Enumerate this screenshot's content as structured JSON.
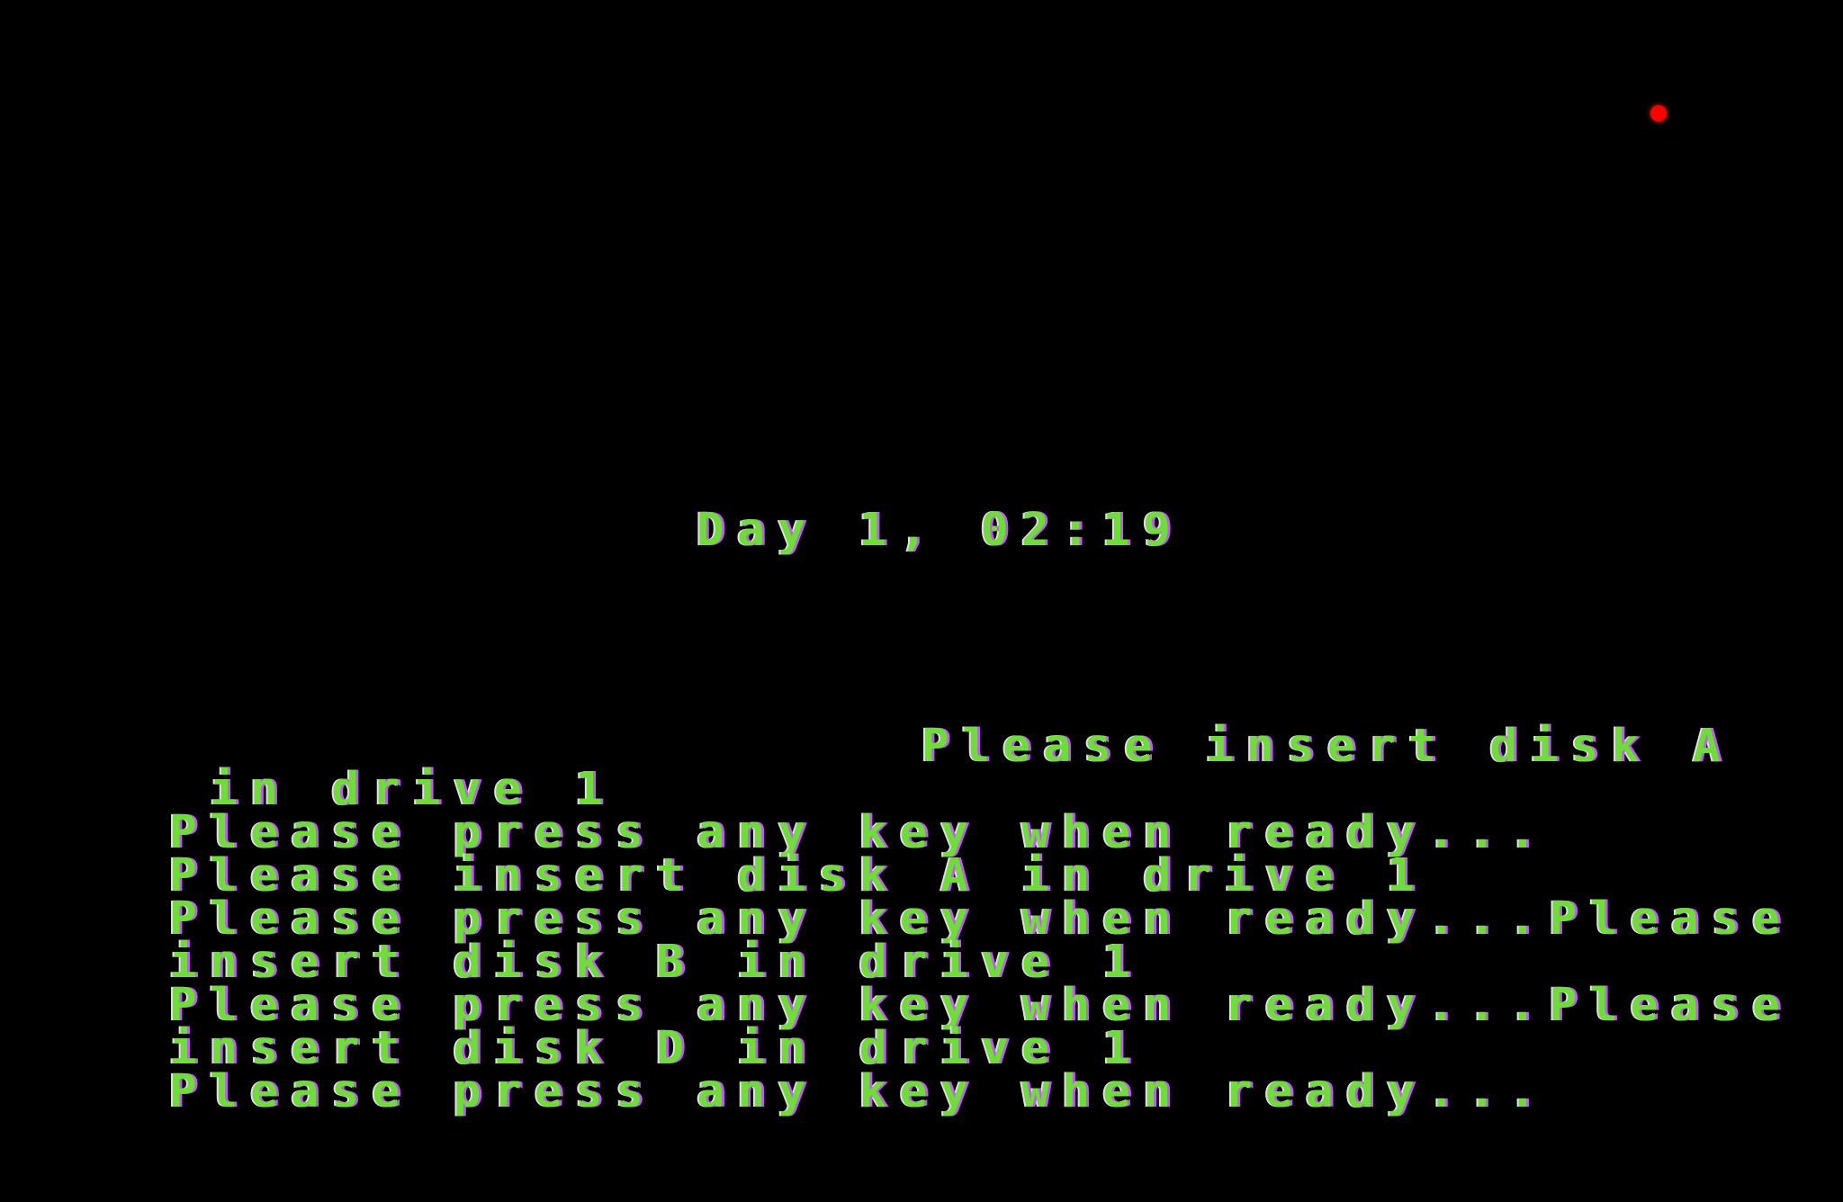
{
  "screen": {
    "clock": "Day 1, 02:19",
    "lines": [
      "Please insert disk A",
      " in drive 1",
      "Please press any key when ready...",
      "Please insert disk A in drive 1",
      "Please press any key when ready...Please",
      "insert disk B in drive 1",
      "Please press any key when ready...Please",
      "insert disk D in drive 1",
      "Please press any key when ready..."
    ]
  },
  "colors": {
    "background": "#000000",
    "text_green": "#6fdc3c",
    "text_purple": "#c35cf0",
    "drive_led": "#ff0000"
  },
  "icons": {
    "drive_led": "disk-activity-led-icon"
  }
}
